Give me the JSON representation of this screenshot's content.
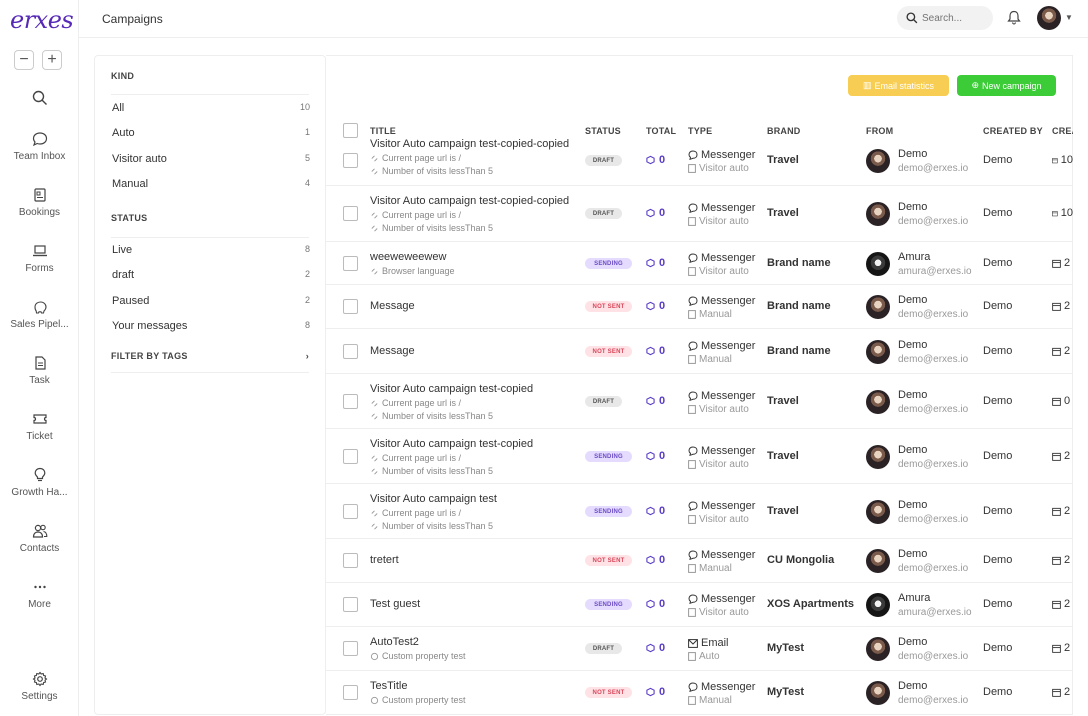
{
  "app": {
    "logo": "erxes"
  },
  "header": {
    "title": "Campaigns",
    "search_placeholder": "Search..."
  },
  "sidebar": {
    "zoom_out": "−",
    "zoom_in": "+",
    "items": [
      {
        "label": "",
        "icon": "search-icon"
      },
      {
        "label": "Team Inbox",
        "icon": "chat-icon"
      },
      {
        "label": "Bookings",
        "icon": "bookings-icon"
      },
      {
        "label": "Forms",
        "icon": "laptop-icon"
      },
      {
        "label": "Sales Pipel...",
        "icon": "piggy-icon"
      },
      {
        "label": "Task",
        "icon": "task-icon"
      },
      {
        "label": "Ticket",
        "icon": "ticket-icon"
      },
      {
        "label": "Growth Ha...",
        "icon": "bulb-icon"
      },
      {
        "label": "Contacts",
        "icon": "contacts-icon"
      },
      {
        "label": "More",
        "icon": "more-icon"
      },
      {
        "label": "Settings",
        "icon": "gear-icon"
      }
    ]
  },
  "filters": {
    "kind_heading": "KIND",
    "kind": [
      {
        "label": "All",
        "count": "10"
      },
      {
        "label": "Auto",
        "count": "1"
      },
      {
        "label": "Visitor auto",
        "count": "5"
      },
      {
        "label": "Manual",
        "count": "4"
      }
    ],
    "status_heading": "STATUS",
    "status": [
      {
        "label": "Live",
        "count": "8"
      },
      {
        "label": "draft",
        "count": "2"
      },
      {
        "label": "Paused",
        "count": "2"
      },
      {
        "label": "Your messages",
        "count": "8"
      }
    ],
    "tags_heading": "FILTER BY TAGS"
  },
  "actions": {
    "email_statistics": "Email statistics",
    "new_campaign": "New campaign"
  },
  "table": {
    "columns": [
      "TITLE",
      "STATUS",
      "TOTAL",
      "TYPE",
      "BRAND",
      "FROM",
      "CREATED BY",
      "CREA"
    ],
    "rows": [
      {
        "title": "Visitor Auto campaign test-copied-copied",
        "subs": [
          "Current page url is /",
          "Number of visits lessThan 5"
        ],
        "status": "DRAFT",
        "total": "0",
        "type": "Messenger",
        "type_sub": "Visitor auto",
        "brand": "Travel",
        "from_name": "Demo",
        "from_email": "demo@erxes.io",
        "created_by": "Demo",
        "date": "10"
      },
      {
        "title": "Visitor Auto campaign test-copied-copied",
        "subs": [
          "Current page url is /",
          "Number of visits lessThan 5"
        ],
        "status": "DRAFT",
        "total": "0",
        "type": "Messenger",
        "type_sub": "Visitor auto",
        "brand": "Travel",
        "from_name": "Demo",
        "from_email": "demo@erxes.io",
        "created_by": "Demo",
        "date": "10"
      },
      {
        "title": "weeweweewew",
        "subs": [
          "Browser language"
        ],
        "status": "SENDING",
        "total": "0",
        "type": "Messenger",
        "type_sub": "Visitor auto",
        "brand": "Brand name",
        "from_name": "Amura",
        "from_email": "amura@erxes.io",
        "created_by": "Demo",
        "date": "2"
      },
      {
        "title": "Message",
        "subs": [],
        "status": "NOT SENT",
        "total": "0",
        "type": "Messenger",
        "type_sub": "Manual",
        "brand": "Brand name",
        "from_name": "Demo",
        "from_email": "demo@erxes.io",
        "created_by": "Demo",
        "date": "2"
      },
      {
        "title": "Message",
        "subs": [],
        "status": "NOT SENT",
        "total": "0",
        "type": "Messenger",
        "type_sub": "Manual",
        "brand": "Brand name",
        "from_name": "Demo",
        "from_email": "demo@erxes.io",
        "created_by": "Demo",
        "date": "2"
      },
      {
        "title": "Visitor Auto campaign test-copied",
        "subs": [
          "Current page url is /",
          "Number of visits lessThan 5"
        ],
        "status": "DRAFT",
        "total": "0",
        "type": "Messenger",
        "type_sub": "Visitor auto",
        "brand": "Travel",
        "from_name": "Demo",
        "from_email": "demo@erxes.io",
        "created_by": "Demo",
        "date": "0"
      },
      {
        "title": "Visitor Auto campaign test-copied",
        "subs": [
          "Current page url is /",
          "Number of visits lessThan 5"
        ],
        "status": "SENDING",
        "total": "0",
        "type": "Messenger",
        "type_sub": "Visitor auto",
        "brand": "Travel",
        "from_name": "Demo",
        "from_email": "demo@erxes.io",
        "created_by": "Demo",
        "date": "2"
      },
      {
        "title": "Visitor Auto campaign test",
        "subs": [
          "Current page url is /",
          "Number of visits lessThan 5"
        ],
        "status": "SENDING",
        "total": "0",
        "type": "Messenger",
        "type_sub": "Visitor auto",
        "brand": "Travel",
        "from_name": "Demo",
        "from_email": "demo@erxes.io",
        "created_by": "Demo",
        "date": "2"
      },
      {
        "title": "tretert",
        "subs": [],
        "status": "NOT SENT",
        "total": "0",
        "type": "Messenger",
        "type_sub": "Manual",
        "brand": "CU Mongolia",
        "from_name": "Demo",
        "from_email": "demo@erxes.io",
        "created_by": "Demo",
        "date": "2"
      },
      {
        "title": "Test guest",
        "subs": [],
        "status": "SENDING",
        "total": "0",
        "type": "Messenger",
        "type_sub": "Visitor auto",
        "brand": "XOS Apartments",
        "from_name": "Amura",
        "from_email": "amura@erxes.io",
        "created_by": "Demo",
        "date": "2"
      },
      {
        "title": "AutoTest2",
        "subs": [
          "Custom property test"
        ],
        "status": "DRAFT",
        "total": "0",
        "type": "Email",
        "type_sub": "Auto",
        "brand": "MyTest",
        "from_name": "Demo",
        "from_email": "demo@erxes.io",
        "created_by": "Demo",
        "date": "2"
      },
      {
        "title": "TesTitle",
        "subs": [
          "Custom property test"
        ],
        "status": "NOT SENT",
        "total": "0",
        "type": "Messenger",
        "type_sub": "Manual",
        "brand": "MyTest",
        "from_name": "Demo",
        "from_email": "demo@erxes.io",
        "created_by": "Demo",
        "date": "2"
      }
    ]
  }
}
